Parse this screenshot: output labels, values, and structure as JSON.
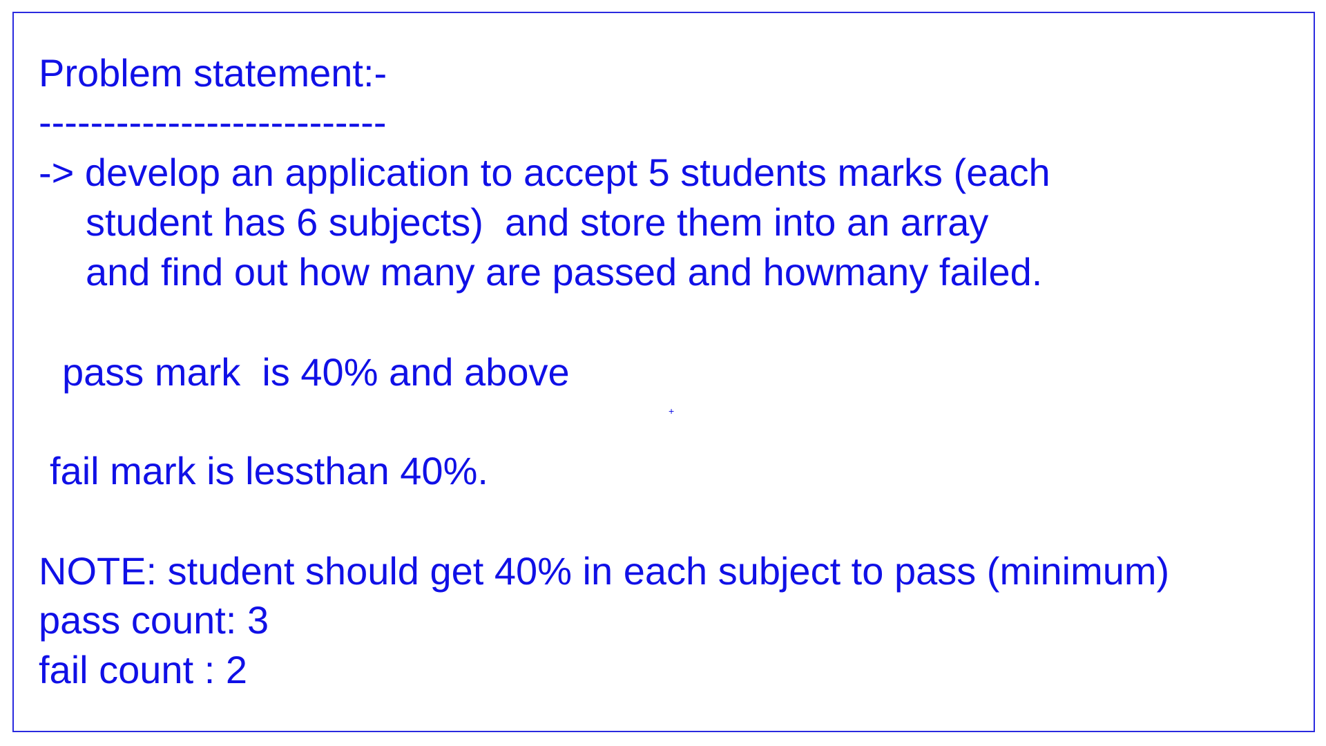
{
  "colors": {
    "text": "#1010e6",
    "border": "#2a2adf",
    "background": "#ffffff"
  },
  "document": {
    "heading": "Problem statement:-",
    "underline": "---------------------------",
    "task_line_1": "-> develop an application to accept 5 students marks (each",
    "task_line_2": "student has 6 subjects)  and store them into an array",
    "task_line_3": "and find out how many are passed and howmany failed.",
    "pass_rule": "pass mark  is 40% and above",
    "marker": "+",
    "fail_rule": "fail mark is lessthan 40%.",
    "note": "NOTE: student should get 40% in each subject to pass (minimum)",
    "pass_count": "pass count: 3",
    "fail_count": "fail count : 2"
  }
}
